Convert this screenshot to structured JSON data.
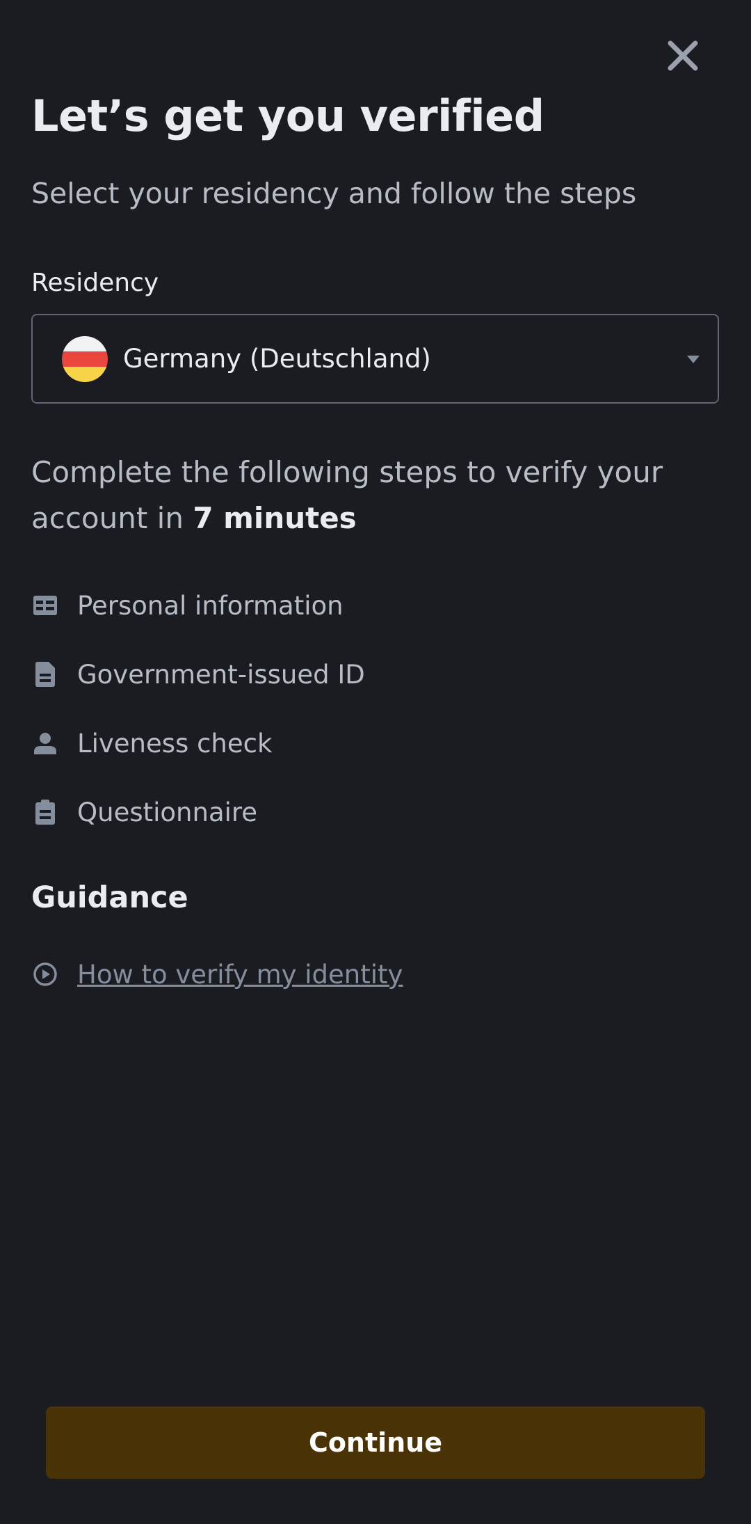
{
  "header": {
    "close_icon": "close-icon",
    "title": "Let’s get you verified",
    "subtitle": "Select your residency and follow the steps"
  },
  "residency": {
    "label": "Residency",
    "selected": "Germany (Deutschland)",
    "flag_colors": [
      "#f2f2f2",
      "#e8463f",
      "#f8d548"
    ],
    "caret_icon": "caret-down-icon"
  },
  "intro": {
    "text": "Complete the following steps to verify your account in ",
    "duration": "7 minutes"
  },
  "steps": [
    {
      "icon": "id-card-icon",
      "label": "Personal information"
    },
    {
      "icon": "document-icon",
      "label": "Government-issued ID"
    },
    {
      "icon": "person-icon",
      "label": "Liveness check"
    },
    {
      "icon": "clipboard-icon",
      "label": "Questionnaire"
    }
  ],
  "guidance": {
    "heading": "Guidance",
    "link_icon": "play-circle-icon",
    "link_text": "How to verify my identity"
  },
  "footer": {
    "continue_label": "Continue"
  },
  "colors": {
    "background": "#1b1c21",
    "primary_text": "#eaecef",
    "secondary_text": "#b7bdc6",
    "icon_gray": "#848e9c",
    "button_bg": "#4a3306"
  }
}
